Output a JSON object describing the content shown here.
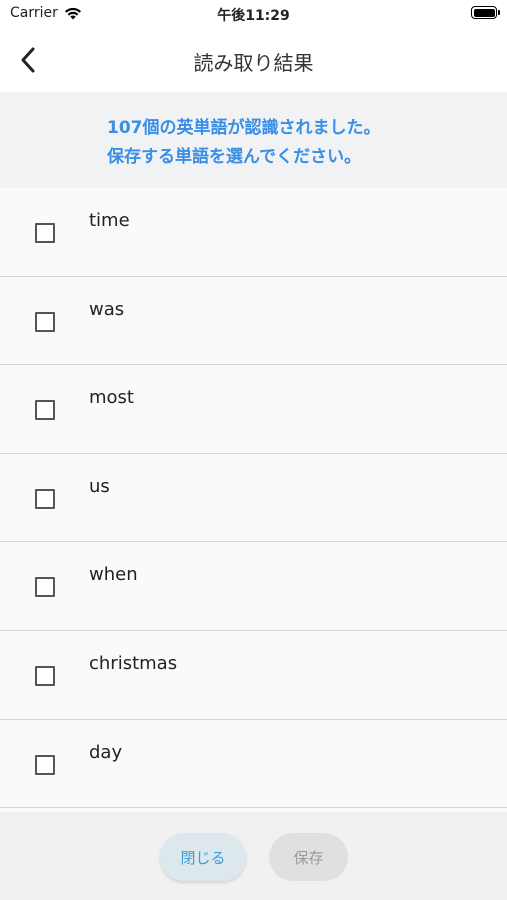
{
  "status_bar": {
    "carrier": "Carrier",
    "time": "午後11:29"
  },
  "nav": {
    "title": "読み取り結果"
  },
  "banner": {
    "line1": "107個の英単語が認識されました。",
    "line2": "保存する単語を選んでください。"
  },
  "words": [
    {
      "label": "time",
      "checked": false
    },
    {
      "label": "was",
      "checked": false
    },
    {
      "label": "most",
      "checked": false
    },
    {
      "label": "us",
      "checked": false
    },
    {
      "label": "when",
      "checked": false
    },
    {
      "label": "christmas",
      "checked": false
    },
    {
      "label": "day",
      "checked": false
    }
  ],
  "footer": {
    "close_label": "閉じる",
    "save_label": "保存"
  },
  "colors": {
    "accent": "#3a8ee6",
    "close_text": "#3a9fd8",
    "disabled_text": "#999999"
  }
}
